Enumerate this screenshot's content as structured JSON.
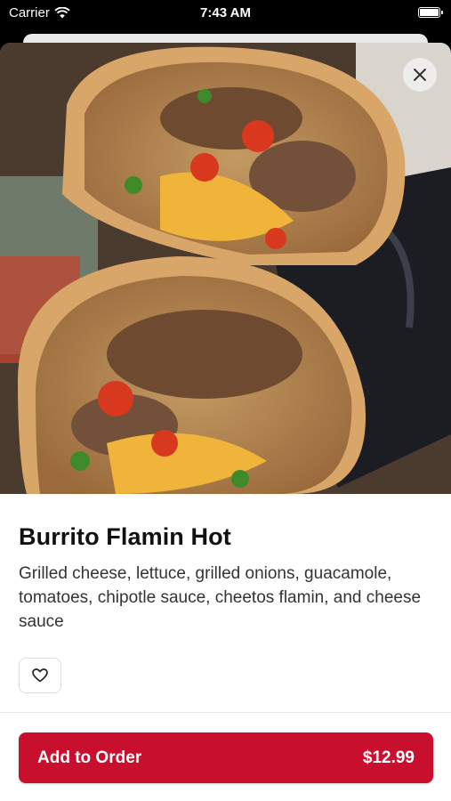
{
  "status_bar": {
    "carrier": "Carrier",
    "time": "7:43 AM"
  },
  "item": {
    "title": "Burrito Flamin Hot",
    "description": "Grilled cheese, lettuce, grilled onions, guacamole, tomatoes, chipotle sauce, cheetos flamin, and cheese sauce"
  },
  "actions": {
    "add_label": "Add to Order",
    "price": "$12.99"
  },
  "icons": {
    "close": "close-icon",
    "favorite": "heart-outline-icon",
    "wifi": "wifi-icon",
    "battery": "battery-icon"
  },
  "colors": {
    "accent": "#c8102e",
    "background": "#ffffff",
    "title": "#111111"
  }
}
